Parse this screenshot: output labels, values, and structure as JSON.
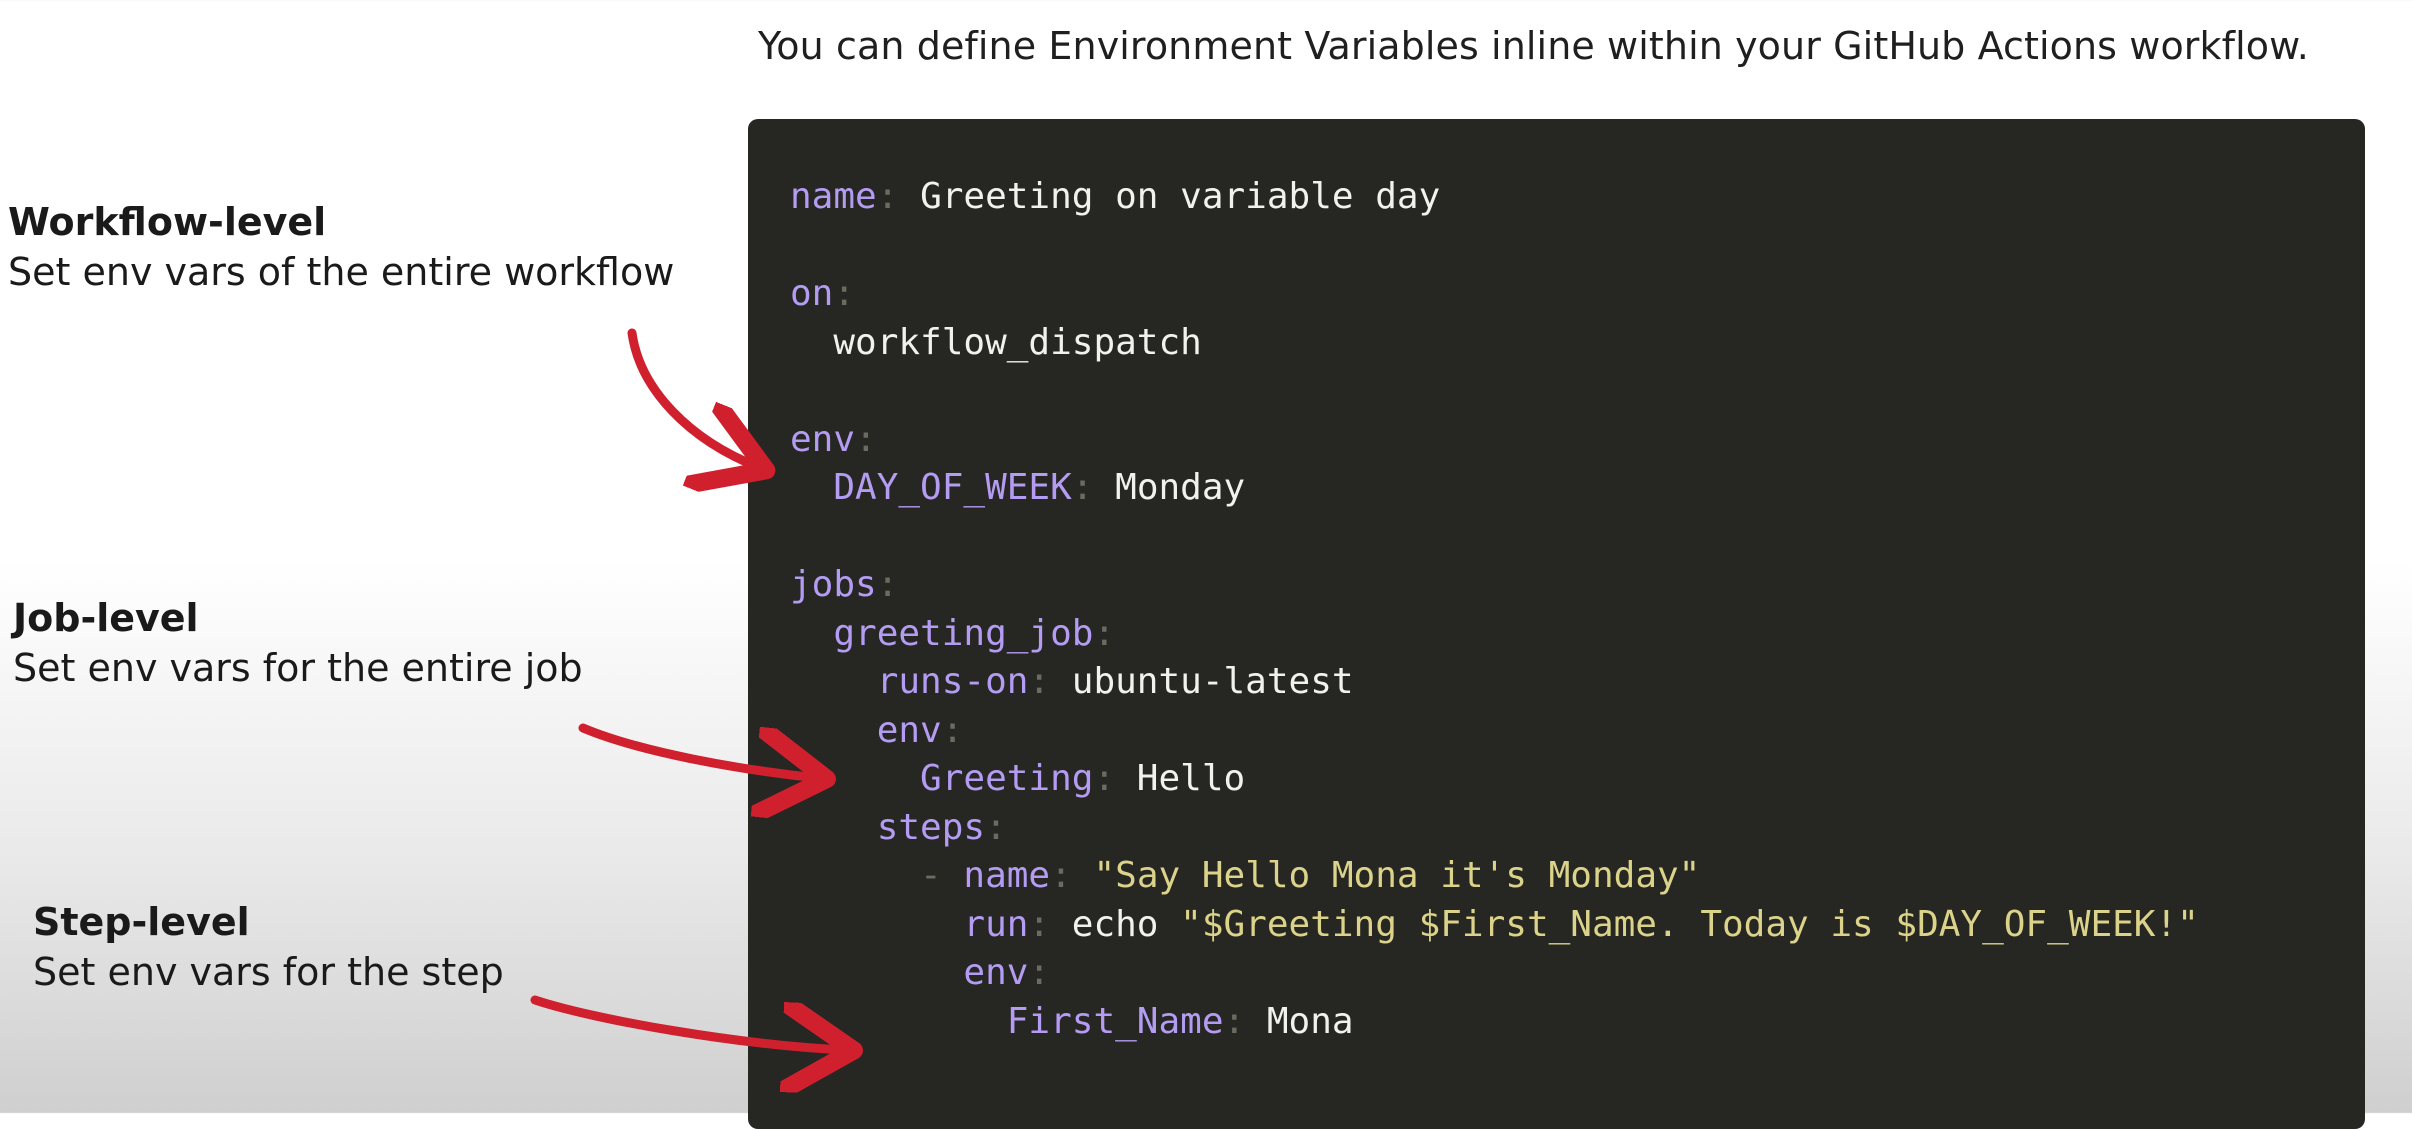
{
  "heading": "You can define Environment Variables inline within your GitHub Actions workflow.",
  "labels": [
    {
      "title": "Workflow-level",
      "description": "Set env vars of the entire workflow"
    },
    {
      "title": "Job-level",
      "description": "Set env vars for the entire job"
    },
    {
      "title": "Step-level",
      "description": "Set env vars for the step"
    }
  ],
  "code": {
    "lines": [
      {
        "indent": "",
        "dash": "",
        "key": "name",
        "colon": ":",
        "value": " Greeting on variable day",
        "value_type": "plain"
      },
      {
        "indent": "",
        "dash": "",
        "key": "",
        "colon": "",
        "value": "",
        "value_type": "plain"
      },
      {
        "indent": "",
        "dash": "",
        "key": "on",
        "colon": ":",
        "value": "",
        "value_type": "plain"
      },
      {
        "indent": "  ",
        "dash": "",
        "key": "",
        "colon": "",
        "value": "workflow_dispatch",
        "value_type": "plain"
      },
      {
        "indent": "",
        "dash": "",
        "key": "",
        "colon": "",
        "value": "",
        "value_type": "plain"
      },
      {
        "indent": "",
        "dash": "",
        "key": "env",
        "colon": ":",
        "value": "",
        "value_type": "plain"
      },
      {
        "indent": "  ",
        "dash": "",
        "key": "DAY_OF_WEEK",
        "colon": ":",
        "value": " Monday",
        "value_type": "plain"
      },
      {
        "indent": "",
        "dash": "",
        "key": "",
        "colon": "",
        "value": "",
        "value_type": "plain"
      },
      {
        "indent": "",
        "dash": "",
        "key": "jobs",
        "colon": ":",
        "value": "",
        "value_type": "plain"
      },
      {
        "indent": "  ",
        "dash": "",
        "key": "greeting_job",
        "colon": ":",
        "value": "",
        "value_type": "plain"
      },
      {
        "indent": "    ",
        "dash": "",
        "key": "runs-on",
        "colon": ":",
        "value": " ubuntu-latest",
        "value_type": "plain"
      },
      {
        "indent": "    ",
        "dash": "",
        "key": "env",
        "colon": ":",
        "value": "",
        "value_type": "plain"
      },
      {
        "indent": "      ",
        "dash": "",
        "key": "Greeting",
        "colon": ":",
        "value": " Hello",
        "value_type": "plain"
      },
      {
        "indent": "    ",
        "dash": "",
        "key": "steps",
        "colon": ":",
        "value": "",
        "value_type": "plain"
      },
      {
        "indent": "      ",
        "dash": "- ",
        "key": "name",
        "colon": ":",
        "value": " \"Say Hello Mona it's Monday\"",
        "value_type": "string"
      },
      {
        "indent": "        ",
        "dash": "",
        "key": "run",
        "colon": ":",
        "value": " echo \"$Greeting $First_Name. Today is $DAY_OF_WEEK!\"",
        "value_type": "mixed"
      },
      {
        "indent": "        ",
        "dash": "",
        "key": "env",
        "colon": ":",
        "value": "",
        "value_type": "plain"
      },
      {
        "indent": "          ",
        "dash": "",
        "key": "First_Name",
        "colon": ":",
        "value": " Mona",
        "value_type": "plain"
      }
    ]
  },
  "colors": {
    "key": "#b49cf2",
    "punctuation": "#6b6b60",
    "value": "#f2f2ec",
    "string": "#dcd38a",
    "panel": "#262622",
    "arrow": "#d0202e"
  }
}
